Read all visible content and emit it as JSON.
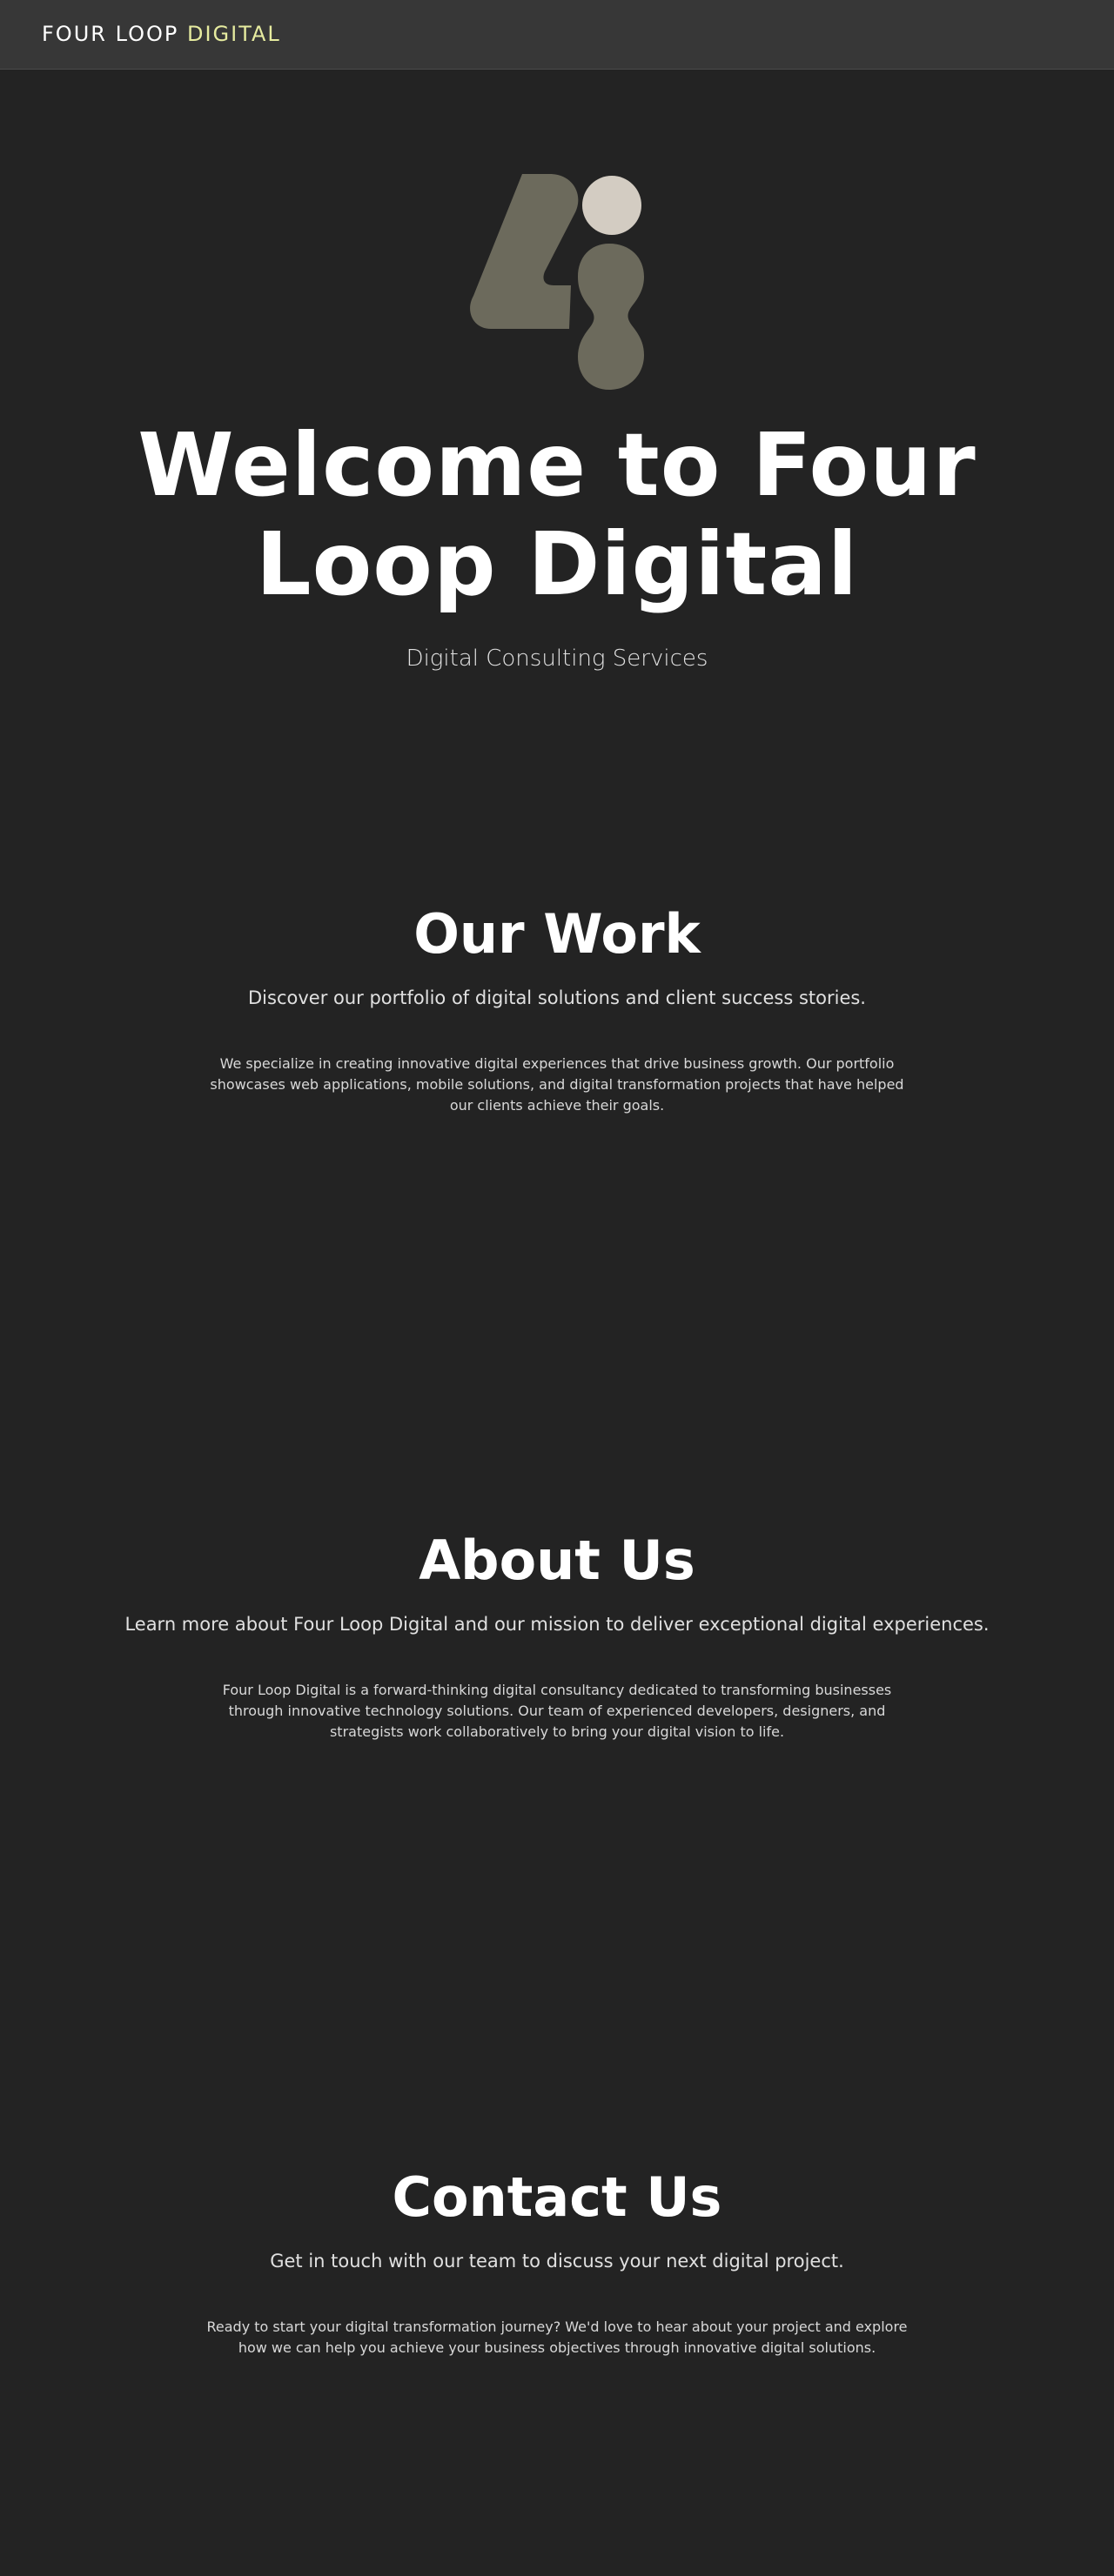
{
  "header": {
    "brand_primary": "FOUR LOOP",
    "brand_accent": "DIGITAL",
    "brand_accent_color": "#e6eb9f"
  },
  "hero": {
    "logo_icon": "four-loop-logo-icon",
    "title": "Welcome to Four Loop Digital",
    "subtitle": "Digital Consulting Services"
  },
  "work": {
    "title": "Our Work",
    "subtitle": "Discover our portfolio of digital solutions and client success stories.",
    "body": "We specialize in creating innovative digital experiences that drive business growth. Our portfolio showcases web applications, mobile solutions, and digital transformation projects that have helped our clients achieve their goals."
  },
  "about": {
    "title": "About Us",
    "subtitle": "Learn more about Four Loop Digital and our mission to deliver exceptional digital experiences.",
    "body": "Four Loop Digital is a forward-thinking digital consultancy dedicated to transforming businesses through innovative technology solutions. Our team of experienced developers, designers, and strategists work collaboratively to bring your digital vision to life."
  },
  "contact": {
    "title": "Contact Us",
    "subtitle": "Get in touch with our team to discuss your next digital project.",
    "body": "Ready to start your digital transformation journey? We'd love to hear about your project and explore how we can help you achieve your business objectives through innovative digital solutions."
  },
  "colors": {
    "background": "#232323",
    "header_bg": "#373737",
    "logo_olive": "#6c6a5c",
    "logo_light": "#d3ccc2"
  }
}
